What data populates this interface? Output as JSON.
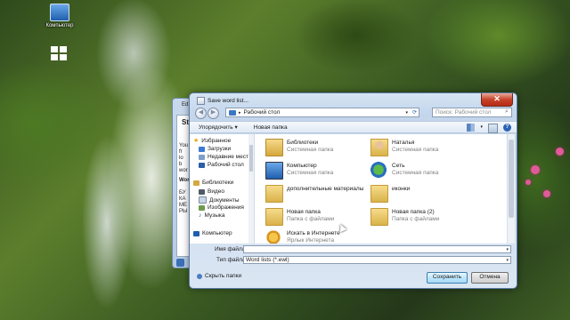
{
  "desktop": {
    "icons": [
      {
        "label": "Компьютер",
        "icon": "computer-icon"
      },
      {
        "label": "",
        "icon": "start-grid-icon"
      }
    ]
  },
  "background_window": {
    "title": "Ed",
    "heading": "St",
    "lines": [
      "You",
      "fr",
      "lo",
      "b",
      "wor",
      "Wor",
      "БУ",
      "КА",
      "МЕ",
      "РЫ"
    ]
  },
  "dialog": {
    "title": "Save word list...",
    "close_label": "✕",
    "address": "Рабочий стол",
    "search_placeholder": "Поиск: Рабочий стол",
    "toolbar": {
      "organize": "Упорядочить ▾",
      "new_folder": "Новая папка"
    },
    "nav": {
      "favorites_header": "Избранное",
      "favorites": [
        "Загрузки",
        "Недавние места",
        "Рабочий стол"
      ],
      "libraries_header": "Библиотеки",
      "libraries": [
        "Видео",
        "Документы",
        "Изображения",
        "Музыка"
      ],
      "computer": "Компьютер"
    },
    "items": [
      {
        "name": "Библиотеки",
        "sub": "Системная папка",
        "icon": "library-icon"
      },
      {
        "name": "Наталья",
        "sub": "Системная папка",
        "icon": "user-folder-icon"
      },
      {
        "name": "Компьютер",
        "sub": "Системная папка",
        "icon": "computer-icon"
      },
      {
        "name": "Сеть",
        "sub": "Системная папка",
        "icon": "network-icon"
      },
      {
        "name": "дополнительные материалы",
        "sub": "",
        "icon": "folder-icon"
      },
      {
        "name": "иконки",
        "sub": "",
        "icon": "folder-icon"
      },
      {
        "name": "Новая папка",
        "sub": "Папка с файлами",
        "icon": "folder-icon"
      },
      {
        "name": "Новая папка (2)",
        "sub": "Папка с файлами",
        "icon": "folder-icon"
      },
      {
        "name": "Искать в Интернете",
        "sub": "Ярлык Интернета",
        "icon": "search-web-icon"
      }
    ],
    "filename_label": "Имя файла:",
    "filename_value": "",
    "filetype_label": "Тип файла:",
    "filetype_value": "Word lists (*.ewl)",
    "hide_folders": "Скрыть папки",
    "save": "Сохранить",
    "cancel": "Отмена"
  }
}
